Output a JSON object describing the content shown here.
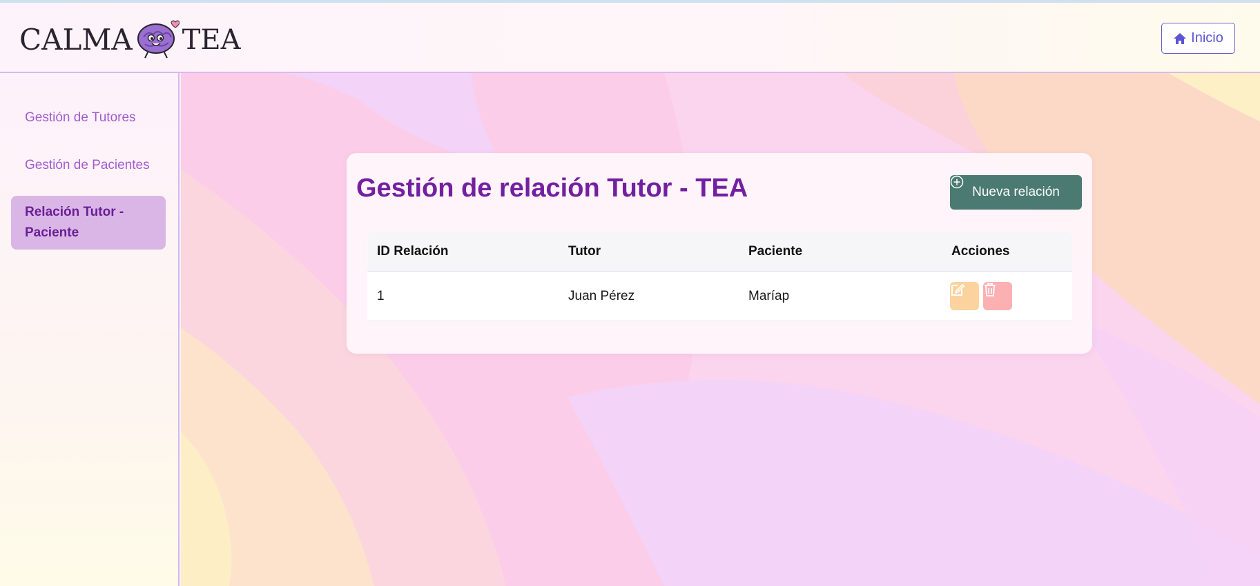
{
  "header": {
    "logo_left": "CALMA",
    "logo_right": "TEA",
    "home_label": "Inicio"
  },
  "sidebar": {
    "items": [
      {
        "label": "Gestión de Tutores"
      },
      {
        "label": "Gestión de Pacientes"
      },
      {
        "label": "Relación Tutor - Paciente",
        "active": true
      }
    ]
  },
  "main": {
    "title": "Gestión de relación Tutor - TEA",
    "new_button": "Nueva relación",
    "table": {
      "headers": [
        "ID Relación",
        "Tutor",
        "Paciente",
        "Acciones"
      ],
      "rows": [
        {
          "id": "1",
          "tutor": "Juan Pérez",
          "paciente": "Maríap"
        }
      ]
    }
  },
  "icons": {
    "home": "home-icon",
    "add": "plus-circle-icon",
    "edit": "edit-icon",
    "delete": "trash-icon"
  },
  "colors": {
    "accent_purple": "#7220a0",
    "button_green": "#4a7a72",
    "edit": "#fcd39e",
    "delete": "#fbb0b2"
  }
}
